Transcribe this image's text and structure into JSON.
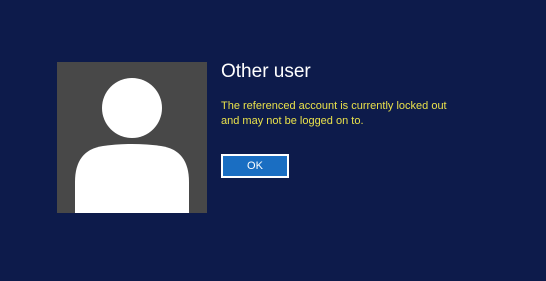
{
  "account": {
    "username": "Other user",
    "avatar_icon": "user-silhouette-icon"
  },
  "message": {
    "text": "The referenced account is currently locked out and may not be logged on to."
  },
  "actions": {
    "ok_label": "OK"
  },
  "colors": {
    "background": "#0d1b4b",
    "tile": "#484848",
    "message_text": "#e9e14b",
    "button": "#1a6ec2"
  }
}
